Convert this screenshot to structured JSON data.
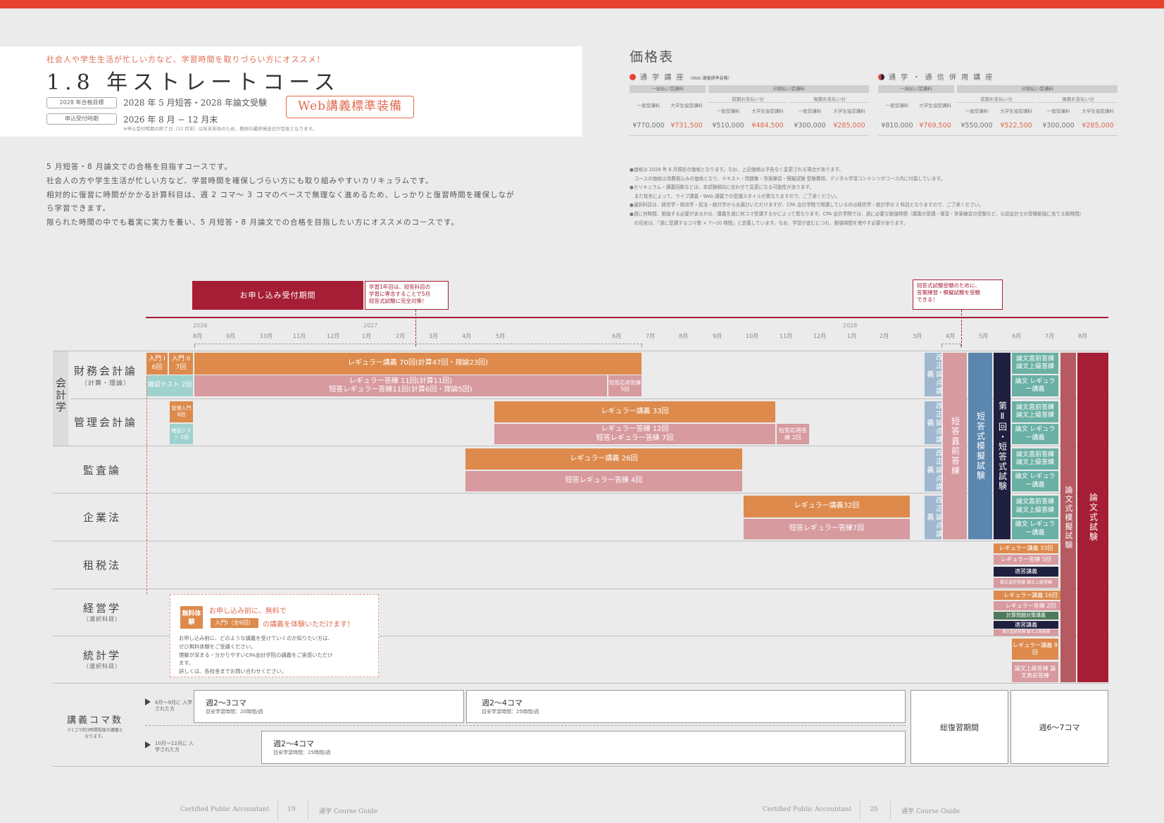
{
  "header": {
    "tagline": "社会人や学生生活が忙しい方など、学習時間を取りづらい方にオススメ！",
    "title": "1.8 年ストレートコース",
    "target_label": "2028 年合格目標",
    "target_value": "2028 年 5 月短答・2028 年論文受験",
    "apply_label": "申込受付時期",
    "apply_value": "2026 年 8 月 − 12 月末",
    "web_badge": "Web講義標準装備",
    "apply_note": "※申込受付時期の終了日（12 月末）は年末年始のため、教材の最終発送日が目安となります。"
  },
  "description": [
    "5 月短答・8 月論文での合格を目指すコースです。",
    "社会人の方や学生生活が忙しい方など、学習時間を確保しづらい方にも取り組みやすいカリキュラムです。",
    "相対的に復習に時間がかかる計算科目は、週 2 コマ〜 3 コマのペースで無理なく進めるため、しっかりと復習時間を確保しなが",
    "ら学習できます。",
    "限られた時間の中でも着実に実力を養い、5 月短答・8 月論文での合格を目指したい方にオススメのコースです。"
  ],
  "pricing": {
    "title": "価格表",
    "left_heading": "通 学 講 座",
    "left_sub": "（Web 講義標準装備）",
    "right_heading": "通 学 ・ 通 信 併 用 講 座",
    "lump": "一括払い受講料",
    "split": "分割払い受講料",
    "early": "前期お支払い分",
    "late": "後期お支払い分",
    "general": "一般受講料",
    "student": "大学生協受講料",
    "left_values": [
      "¥770,000",
      "¥731,500",
      "¥510,000",
      "¥484,500",
      "¥300,000",
      "¥285,000"
    ],
    "right_values": [
      "¥810,000",
      "¥769,500",
      "¥550,000",
      "¥522,500",
      "¥300,000",
      "¥285,000"
    ],
    "colors": {
      "accent": "#e06a50",
      "dark": "#a61e35"
    }
  },
  "notes": [
    "●価格は 2026 年 8 月現在の価格となります。なお、上記価格は予告なく変更される場合があります。",
    "　コースの価格は消費税込みの価格となり、テキスト・問題集・答案練習・模擬試験 受験費用、デジタル学習コンテンツがコース内に付属しています。",
    "●カリキュラム・講義回数などは、本試験傾向に合わせて変更になる可能性があります。",
    "　また校舎によって、ライブ講義・Web 講義での受講スタイルが異なりますので、ご了承ください。",
    "●選択科目は、経営学・経済学・民法・統計学からお選びいただけますが、CPA 会計学院で開講しているのは経営学・統計学の 2 科目となりますので、ご了承ください。",
    "●週に何時間、勉強する必要があるかは、講義を週に何コマ受講するかによって異なります。CPA 会計学院では、週に必要な勉強時間（講義の受講・復習・答案練習の受験など、公認会計士の受験勉強に充てる総時間）",
    "　の目安は、「週に受講するコマ数 × 7〜10 時間」と定義しています。なお、学習が進むにつれ、勉強時間を増やす必要があります。"
  ],
  "timeline": {
    "apply_period": "お申し込み受付期間",
    "callout1": [
      "学習1年目は、短答科目の",
      "学習に専念することで5月",
      "短答式試験に完全対策！"
    ],
    "callout2": [
      "短答式試験受験のために、",
      "答案練習・模擬試験を受験",
      "できる！"
    ],
    "years": [
      "2026",
      "2027",
      "2028"
    ],
    "months": [
      "8月",
      "9月",
      "10月",
      "11月",
      "12月",
      "1月",
      "2月",
      "3月",
      "4月",
      "5月",
      "6月",
      "7月",
      "8月",
      "9月",
      "10月",
      "11月",
      "12月",
      "1月",
      "2月",
      "3月",
      "4月",
      "5月",
      "6月",
      "7月",
      "8月"
    ]
  },
  "rows": {
    "group": "会計学",
    "financial": "財務会計論",
    "financial_sub": "（計算・理論）",
    "management": "管理会計論",
    "audit": "監査論",
    "corporate": "企業法",
    "tax": "租税法",
    "business": "経営学",
    "business_sub": "（選択科目）",
    "stats": "統計学",
    "stats_sub": "（選択科目）",
    "koma": "講義コマ数",
    "koma_sub": "※1コマ約3時間程度の講義となります。"
  },
  "bars": {
    "fin_intro1": "入門 I 6回",
    "fin_intro2": "入門 II 7回",
    "fin_regular": "レギュラー講義 70回(計算47回・理論23回)",
    "fin_check": "確認テスト 2回",
    "fin_ans1": "レギュラー答練 11回(計算11回)",
    "fin_ans2": "短答レギュラー答練11回(計算6回・理論5回)",
    "fin_short_app": "短答応用答練 5回",
    "mgmt_intro": "管理入門 8回",
    "mgmt_check": "確認テスト 1回",
    "mgmt_regular": "レギュラー講義 33回",
    "mgmt_ans1": "レギュラー答練 12回",
    "mgmt_ans2": "短答レギュラー答練 7回",
    "mgmt_app": "短答応用答練 2回",
    "audit_regular": "レギュラー講義 26回",
    "audit_ans": "短答レギュラー答練 4回",
    "corp_regular": "レギュラー講義32回",
    "corp_ans": "短答レギュラー答練7回",
    "revision": "改正論点講義",
    "pre_exam": "短答直前答練",
    "mock": "短答式模擬試験",
    "exam2": "第Ⅱ回・短答式試験",
    "ronbun_prep1": "論文直前答練 論文上級答練",
    "ronbun_reg": "論文 レギュラー講義",
    "ronbun_mock": "論文式模擬試験",
    "ronbun_exam": "論文式試験",
    "tax_reg": "レギュラー講義 33回",
    "tax_ans": "レギュラー答練 5回",
    "tax_ex": "適習講義",
    "bus_reg": "レギュラー講義 16回",
    "bus_ans": "レギュラー答練 2回",
    "bus_calc": "計算問題対策講義",
    "bus_ex": "適習講義",
    "stat_reg": "レギュラー講義 9回",
    "stat_adv": "論文上級答練 論文直前答練"
  },
  "free_trial": {
    "badge": "無料体験",
    "line1": "お申し込み前に、無料で",
    "pill": "入門Ⅰ（全6回）",
    "line2": "の講義を体験いただけます！",
    "body": [
      "お申し込み前に、どのような講義を受けていくのか知りたい方は、",
      "ぜひ無料体験をご受講ください。",
      "理解が深まる・分かりやすいCPA会計学院の講義をご実感いただけ",
      "ます。",
      "詳しくは、各校舎までお問い合わせください。"
    ]
  },
  "koma": {
    "row1_label": "8月〜9月に 入学された方",
    "row2_label": "10月〜12月に 入学された方",
    "c1_title": "週2〜3コマ",
    "c1_sub": "目安学習時間：20時間/週",
    "c2_title": "週2〜4コマ",
    "c2_sub": "目安学習時間：25時間/週",
    "c3_title": "週2〜4コマ",
    "c3_sub": "目安学習時間：25時間/週",
    "review": "総復習期間",
    "final": "週6〜7コマ"
  },
  "footer": {
    "left_text": "Certified Public Accountant",
    "left_page": "19",
    "left_guide": "通学 Course Guide",
    "right_text": "Certified Public Accountant",
    "right_page": "20",
    "right_guide": "通学 Course Guide"
  }
}
